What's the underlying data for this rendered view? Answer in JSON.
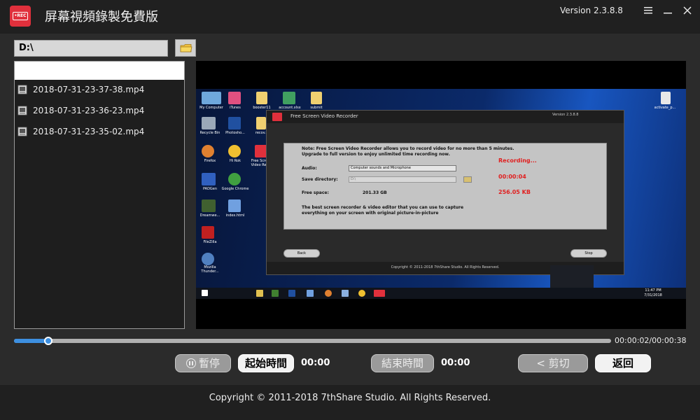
{
  "app": {
    "logo_text": "•REC",
    "title": "屏幕視頻錄製免費版",
    "version": "Version 2.3.8.8",
    "menu_icon": "menu-icon",
    "minimize_icon": "minimize-icon",
    "close_icon": "close-icon"
  },
  "path_bar": {
    "value": "D:\\",
    "folder_icon": "folder-icon"
  },
  "file_list": {
    "items": [
      {
        "name": "2018-07-31-23-37-38.mp4",
        "icon": "video-file-icon"
      },
      {
        "name": "2018-07-31-23-36-23.mp4",
        "icon": "video-file-icon"
      },
      {
        "name": "2018-07-31-23-35-02.mp4",
        "icon": "video-file-icon"
      }
    ]
  },
  "preview": {
    "desktop_icons": [
      {
        "label": "My Computer"
      },
      {
        "label": "iTunes"
      },
      {
        "label": "booster11"
      },
      {
        "label": "account.xlsx"
      },
      {
        "label": "submit"
      },
      {
        "label": "Recycle Bin"
      },
      {
        "label": "Photosho..."
      },
      {
        "label": "recov..."
      },
      {
        "label": "Firefox"
      },
      {
        "label": "Hi Rok"
      },
      {
        "label": "Free Scree Video Re..."
      },
      {
        "label": "PADGen"
      },
      {
        "label": "Google Chrome"
      },
      {
        "label": "Dreamwe..."
      },
      {
        "label": "index.html"
      },
      {
        "label": "FileZilla"
      },
      {
        "label": "Mozilla Thunder..."
      },
      {
        "label": "activate_p..."
      }
    ],
    "inner_window": {
      "title": "Free Screen Video Recorder",
      "version": "Version 2.3.8.8",
      "note_line1": "Note: Free Screen Video Recorder allows you to record video for no more than 5 minutes.",
      "note_line2": "Upgrade to full version to enjoy unlimited time recording now.",
      "audio_label": "Audio:",
      "audio_value": "Computer sounds and Microphone",
      "save_dir_label": "Save directory:",
      "save_dir_value": "D:\\",
      "free_space_label": "Free space:",
      "free_space_value": "201.33 GB",
      "status": "Recording...",
      "elapsed": "00:00:04",
      "size": "256.05 KB",
      "promo_line1": "The best screen recorder & video editor that you can use to capture",
      "promo_line2": "everything on your screen with original picture-in-picture",
      "back_label": "Back",
      "stop_label": "Stop",
      "copyright": "Copyright © 2011-2018 7thShare Studio. All Rights Reserved."
    },
    "clock_time": "11:47 PM",
    "clock_date": "7/31/2018"
  },
  "playback": {
    "progress": 0.058,
    "time_display": "00:00:02/00:00:38"
  },
  "controls": {
    "pause_label": "暫停",
    "start_time_label": "起始時間",
    "start_time_value": "00:00",
    "end_time_label": "結束時間",
    "end_time_value": "00:00",
    "cut_label": "< 剪切",
    "back_label": "返回"
  },
  "footer": {
    "copyright": "Copyright © 2011-2018 7thShare Studio. All Rights Reserved."
  },
  "colors": {
    "accent": "#3d8fe0",
    "logo_red": "#e0303c",
    "recording_red": "#e02020"
  }
}
